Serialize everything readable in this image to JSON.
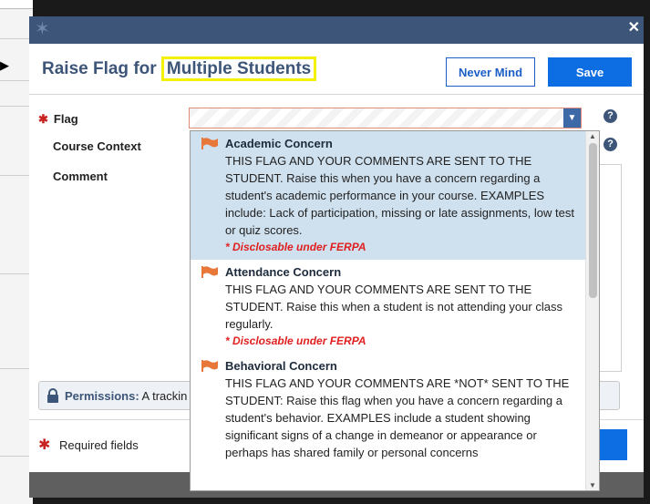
{
  "dialog": {
    "title_prefix": "Raise Flag for ",
    "title_highlight": "Multiple Students",
    "never_mind_label": "Never Mind",
    "save_label": "Save"
  },
  "form": {
    "flag_label": "Flag",
    "course_context_label": "Course Context",
    "comment_label": "Comment",
    "help_glyph": "?"
  },
  "permissions": {
    "label": "Permissions:",
    "text": " A trackin"
  },
  "footer": {
    "required_text": "Required fields"
  },
  "dropdown": {
    "options": [
      {
        "name": "Academic Concern",
        "description": "THIS FLAG AND YOUR COMMENTS ARE SENT TO THE STUDENT. Raise this when you have a concern regarding a student's academic performance in your course. EXAMPLES include: Lack of participation, missing or late assignments, low test or quiz scores.",
        "note": "* Disclosable under FERPA",
        "selected": true
      },
      {
        "name": "Attendance Concern",
        "description": "THIS FLAG AND YOUR COMMENTS ARE SENT TO THE STUDENT. Raise this when a student is not attending your class regularly.",
        "note": "* Disclosable under FERPA",
        "selected": false
      },
      {
        "name": "Behavioral Concern",
        "description": "THIS FLAG AND YOUR COMMENTS ARE *NOT* SENT TO THE STUDENT: Raise this flag when you have a concern regarding a student's behavior. EXAMPLES include a student showing significant signs of a change in demeanor or appearance or perhaps has shared family or personal concerns",
        "note": "",
        "selected": false
      }
    ]
  },
  "colors": {
    "title_blue": "#3d5578",
    "primary_button": "#0d6de2",
    "flag_orange": "#e8773a",
    "ferpa_red": "#e02020",
    "highlight_yellow": "#f5f000"
  },
  "icons": {
    "logo": "star-logo-icon",
    "close": "close-icon",
    "help": "help-icon",
    "lock": "lock-icon",
    "flag": "flag-icon",
    "dropdown": "chevron-down-icon"
  }
}
